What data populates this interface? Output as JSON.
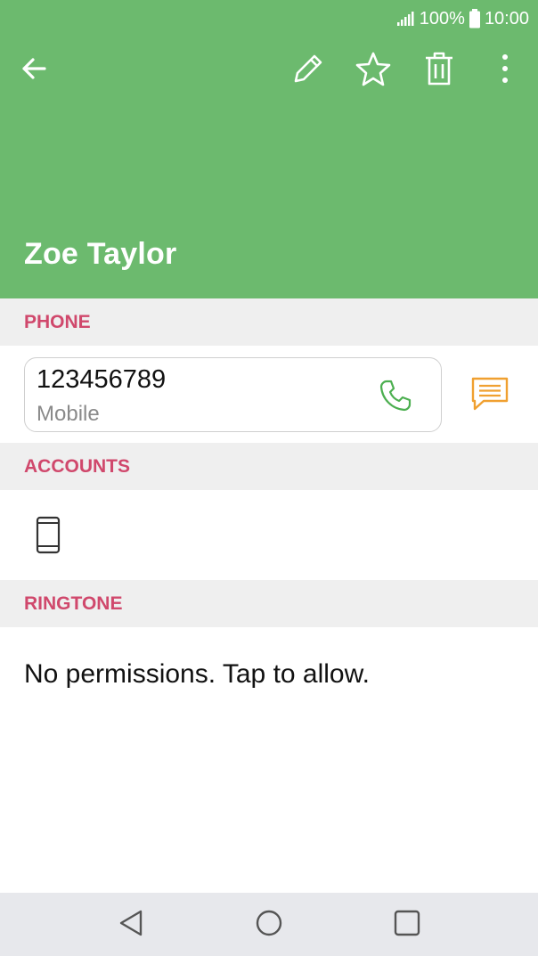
{
  "status_bar": {
    "battery_percent": "100%",
    "time": "10:00",
    "icons": [
      "signal-icon",
      "battery-icon"
    ]
  },
  "toolbar": {
    "icons": [
      "back-arrow-icon",
      "edit-pencil-icon",
      "star-icon",
      "trash-icon",
      "more-vert-icon"
    ]
  },
  "contact": {
    "name": "Zoe Taylor"
  },
  "sections": {
    "phone": "PHONE",
    "accounts": "ACCOUNTS",
    "ringtone": "RINGTONE"
  },
  "phone": {
    "number": "123456789",
    "type": "Mobile",
    "icons": [
      "phone-call-icon",
      "message-icon"
    ]
  },
  "accounts": {
    "icons": [
      "phone-device-icon"
    ]
  },
  "ringtone": {
    "text": "No permissions. Tap to allow."
  },
  "navbar": {
    "icons": [
      "nav-back-icon",
      "nav-home-icon",
      "nav-recents-icon"
    ]
  },
  "colors": {
    "header": "#6cba6e",
    "section_title": "#d0486c",
    "section_bg": "#efefef",
    "call_icon": "#4caf50",
    "message_icon": "#f0a030",
    "navbar_bg": "#e7e8ec"
  }
}
